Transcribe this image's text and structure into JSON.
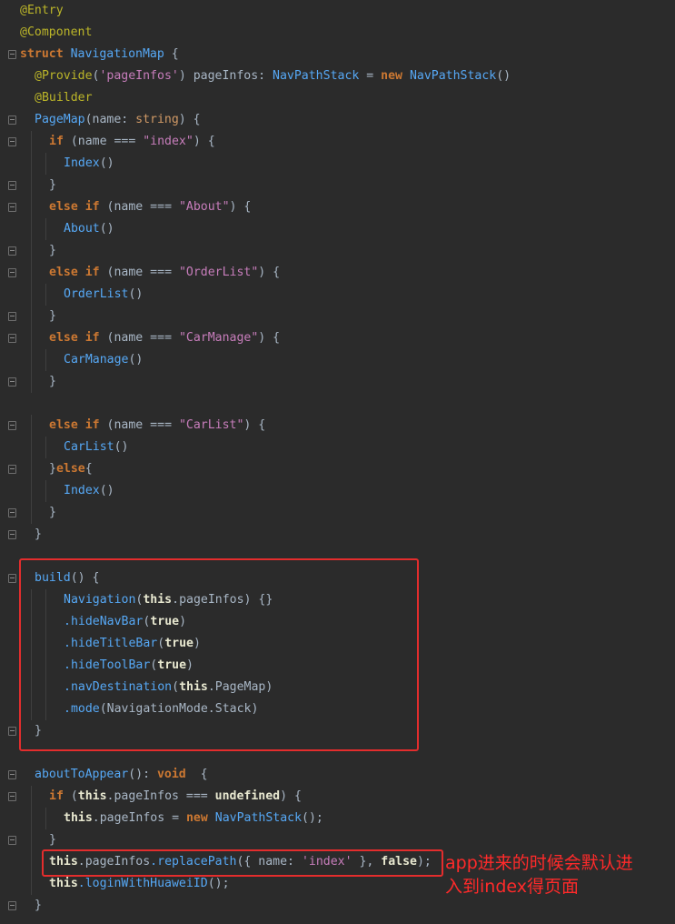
{
  "code_lines": [
    "@Entry",
    "@Component",
    "struct NavigationMap {",
    "  @Provide('pageInfos') pageInfos: NavPathStack = new NavPathStack()",
    "  @Builder",
    "  PageMap(name: string) {",
    "    if (name === \"index\") {",
    "      Index()",
    "    }",
    "    else if (name === \"About\") {",
    "      About()",
    "    }",
    "    else if (name === \"OrderList\") {",
    "      OrderList()",
    "    }",
    "    else if (name === \"CarManage\") {",
    "      CarManage()",
    "    }",
    "",
    "    else if (name === \"CarList\") {",
    "      CarList()",
    "    }else{",
    "      Index()",
    "    }",
    "  }",
    "",
    "  build() {",
    "      Navigation(this.pageInfos) {}",
    "      .hideNavBar(true)",
    "      .hideTitleBar(true)",
    "      .hideToolBar(true)",
    "      .navDestination(this.PageMap)",
    "      .mode(NavigationMode.Stack)",
    "  }",
    "",
    "  aboutToAppear(): void  {",
    "    if (this.pageInfos === undefined) {",
    "      this.pageInfos = new NavPathStack();",
    "    }",
    "    this.pageInfos.replacePath({ name: 'index' }, false);",
    "    this.loginWithHuaweiID();",
    "  }"
  ],
  "annotation_note": {
    "line1": "app进来的时候会默认进",
    "line2": "入到index得页面"
  },
  "colors": {
    "background": "#2b2b2b",
    "highlight_border": "#e32d2d",
    "note_text": "#ff2a2a"
  }
}
